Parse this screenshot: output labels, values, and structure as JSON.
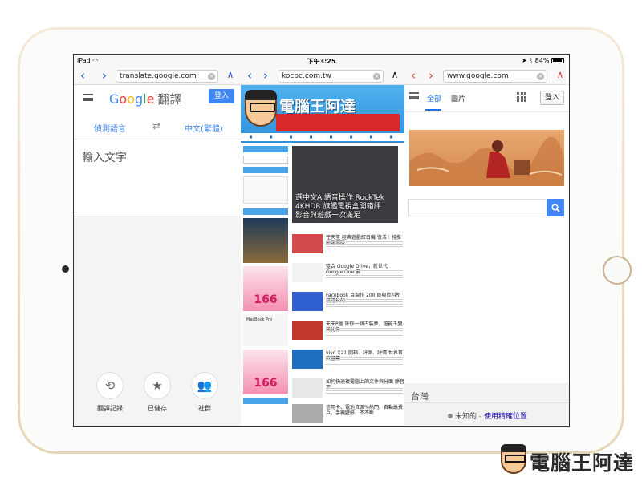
{
  "statusbar": {
    "device": "iPad",
    "time": "下午3:25",
    "battery": "84%"
  },
  "colors": {
    "ios_nav_blue": "#2255d8",
    "google_blue": "#4285f4",
    "kocpc_blue": "#2f8fd8",
    "device_gold": "#e6d6b8"
  },
  "pane1": {
    "url": "translate.google.com",
    "logo": "Google",
    "app_name": "翻譯",
    "signin": "登入",
    "source_lang": "偵測語言",
    "target_lang": "中文(繁體)",
    "input_placeholder": "輸入文字",
    "actions": [
      {
        "label": "翻譯記錄",
        "icon": "history-icon"
      },
      {
        "label": "已儲存",
        "icon": "star-icon"
      },
      {
        "label": "社群",
        "icon": "people-icon"
      }
    ]
  },
  "pane2": {
    "url": "kocpc.com.tw",
    "site_title": "電腦王阿達",
    "hero_lines": [
      "選中文AI語音操作 RockTek",
      "4KHDR 旗艦電視盒開箱評",
      "影音與遊戲一次滿足"
    ],
    "articles": [
      "任天堂 經典遊戲紅白機 復活｜將推出迷你版",
      "整合 Google Drive，新世代 Google One 要",
      "Facebook 目製作 200 頁與資料所護隱私的",
      "天天P圖 許你一個古裝夢，還能千變萬化像",
      "vivo X21 開箱、評測、評價 世界首款螢幕",
      "如何快速複電腦上的文件與分面 靜音 下",
      "信用卡、電池資源％熱門、自動繳費",
      "戶、手機壁紙、不不斷"
    ],
    "sidebar_ad_label": "MacBook Pro",
    "sale_number": "166"
  },
  "pane3": {
    "url": "www.google.com",
    "tab_all": "全部",
    "tab_images": "圖片",
    "signin": "登入",
    "country": "台灣",
    "location_unknown": "未知的",
    "location_link": "使用精確位置"
  },
  "watermark": {
    "text": "電腦王阿達"
  }
}
